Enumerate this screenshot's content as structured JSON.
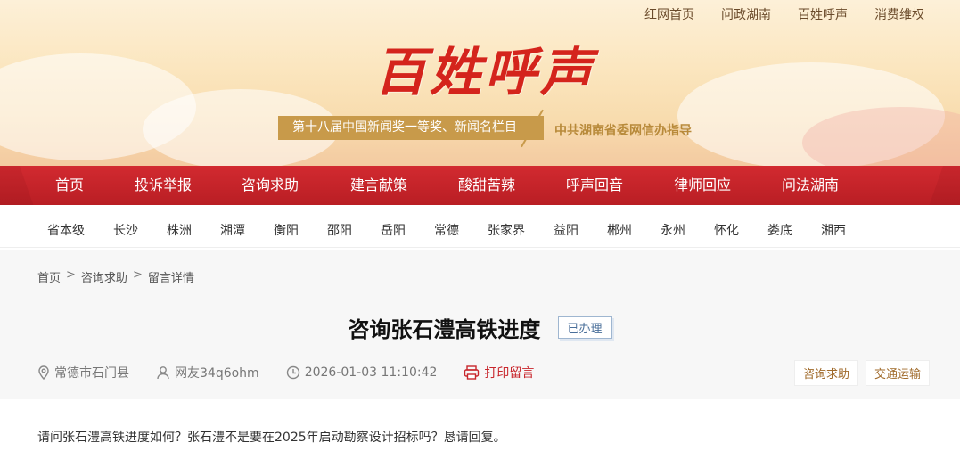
{
  "topnav": [
    "红网首页",
    "问政湖南",
    "百姓呼声",
    "消费维权"
  ],
  "logo": "百姓呼声",
  "award": "第十八届中国新闻奖一等奖、新闻名栏目",
  "guide": "中共湖南省委网信办指导",
  "mainnav": [
    "首页",
    "投诉举报",
    "咨询求助",
    "建言献策",
    "酸甜苦辣",
    "呼声回音",
    "律师回应",
    "问法湖南"
  ],
  "citynav": [
    "省本级",
    "长沙",
    "株洲",
    "湘潭",
    "衡阳",
    "邵阳",
    "岳阳",
    "常德",
    "张家界",
    "益阳",
    "郴州",
    "永州",
    "怀化",
    "娄底",
    "湘西"
  ],
  "breadcrumb": [
    "首页",
    "咨询求助",
    "留言详情"
  ],
  "breadcrumb_sep": ">",
  "post": {
    "title": "咨询张石澧高铁进度",
    "status": "已办理",
    "location": "常德市石门县",
    "user": "网友34q6ohm",
    "time": "2026-01-03 11:10:42",
    "print": "打印留言",
    "tags": [
      "咨询求助",
      "交通运输"
    ],
    "body": "请问张石澧高铁进度如何？张石澧不是要在2025年启动勘察设计招标吗？恳请回复。"
  },
  "colors": {
    "brand_red": "#c8262c",
    "gold": "#c89a4a",
    "status_blue": "#4a6f9a"
  }
}
